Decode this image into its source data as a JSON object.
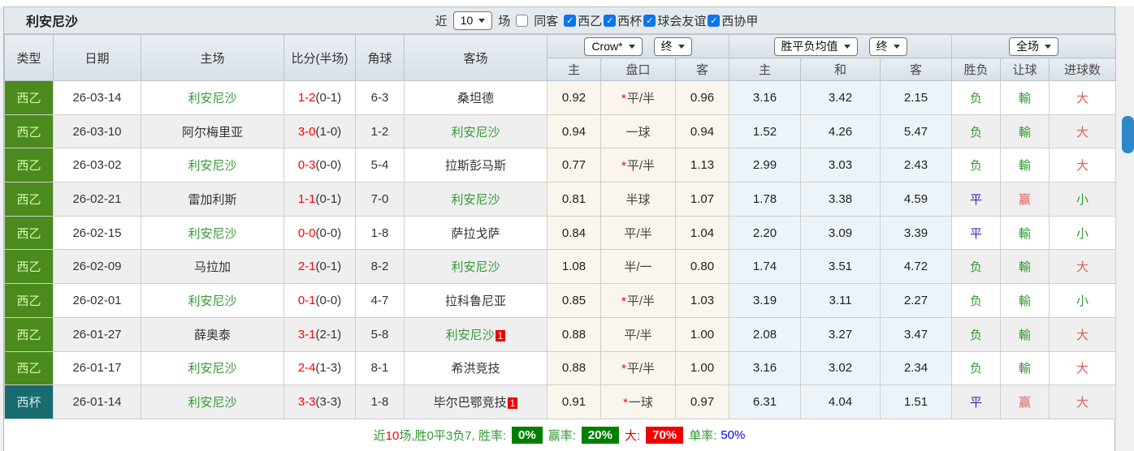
{
  "title": "利安尼沙",
  "controls": {
    "recent_label": "近",
    "recent_value": "10",
    "games_label": "场",
    "same_venue_label": "同客",
    "same_venue_checked": false,
    "checkbox_glyph": "✓",
    "filters": [
      {
        "label": "西乙",
        "checked": true
      },
      {
        "label": "西杯",
        "checked": true
      },
      {
        "label": "球会友谊",
        "checked": true
      },
      {
        "label": "西协甲",
        "checked": true
      }
    ]
  },
  "header": {
    "type": "类型",
    "date": "日期",
    "home": "主场",
    "score": "比分(半场)",
    "corner": "角球",
    "away": "客场",
    "select_odds": "Crow*",
    "select_final1": "终",
    "select_mean": "胜平负均值",
    "select_final2": "终",
    "select_scope": "全场",
    "sub_home1": "主",
    "sub_handicap": "盘口",
    "sub_away1": "客",
    "sub_home2": "主",
    "sub_draw": "和",
    "sub_away2": "客",
    "win_loss": "胜负",
    "handicap_result": "让球",
    "goal_count": "进球数"
  },
  "rows": [
    {
      "type": "西乙",
      "badge": "green",
      "date": "26-03-14",
      "home": "利安尼沙",
      "home_self": true,
      "home_red": "",
      "score": "1-2",
      "half": "(0-1)",
      "corners": "6-3",
      "away": "桑坦德",
      "away_self": false,
      "away_red": "",
      "o1": "0.92",
      "star": "*",
      "hcp": "平/半",
      "o2": "0.96",
      "m1": "3.16",
      "m2": "3.42",
      "m3": "2.15",
      "wl": "负",
      "wl_c": "g",
      "gv": "輸",
      "gv_c": "g",
      "gl": "大",
      "gl_c": "r"
    },
    {
      "type": "西乙",
      "badge": "green",
      "date": "26-03-10",
      "home": "阿尔梅里亚",
      "home_self": false,
      "home_red": "",
      "score": "3-0",
      "half": "(1-0)",
      "corners": "1-2",
      "away": "利安尼沙",
      "away_self": true,
      "away_red": "",
      "o1": "0.94",
      "star": "",
      "hcp": "一球",
      "o2": "0.94",
      "m1": "1.52",
      "m2": "4.26",
      "m3": "5.47",
      "wl": "负",
      "wl_c": "g",
      "gv": "輸",
      "gv_c": "g",
      "gl": "大",
      "gl_c": "r"
    },
    {
      "type": "西乙",
      "badge": "green",
      "date": "26-03-02",
      "home": "利安尼沙",
      "home_self": true,
      "home_red": "",
      "score": "0-3",
      "half": "(0-0)",
      "corners": "5-4",
      "away": "拉斯彭马斯",
      "away_self": false,
      "away_red": "",
      "o1": "0.77",
      "star": "*",
      "hcp": "平/半",
      "o2": "1.13",
      "m1": "2.99",
      "m2": "3.03",
      "m3": "2.43",
      "wl": "负",
      "wl_c": "g",
      "gv": "輸",
      "gv_c": "g",
      "gl": "大",
      "gl_c": "r"
    },
    {
      "type": "西乙",
      "badge": "green",
      "date": "26-02-21",
      "home": "雷加利斯",
      "home_self": false,
      "home_red": "",
      "score": "1-1",
      "half": "(0-1)",
      "corners": "7-0",
      "away": "利安尼沙",
      "away_self": true,
      "away_red": "",
      "o1": "0.81",
      "star": "",
      "hcp": "半球",
      "o2": "1.07",
      "m1": "1.78",
      "m2": "3.38",
      "m3": "4.59",
      "wl": "平",
      "wl_c": "b",
      "gv": "赢",
      "gv_c": "r",
      "gl": "小",
      "gl_c": "g"
    },
    {
      "type": "西乙",
      "badge": "green",
      "date": "26-02-15",
      "home": "利安尼沙",
      "home_self": true,
      "home_red": "",
      "score": "0-0",
      "half": "(0-0)",
      "corners": "1-8",
      "away": "萨拉戈萨",
      "away_self": false,
      "away_red": "",
      "o1": "0.84",
      "star": "",
      "hcp": "平/半",
      "o2": "1.04",
      "m1": "2.20",
      "m2": "3.09",
      "m3": "3.39",
      "wl": "平",
      "wl_c": "b",
      "gv": "輸",
      "gv_c": "g",
      "gl": "小",
      "gl_c": "g"
    },
    {
      "type": "西乙",
      "badge": "green",
      "date": "26-02-09",
      "home": "马拉加",
      "home_self": false,
      "home_red": "",
      "score": "2-1",
      "half": "(0-1)",
      "corners": "8-2",
      "away": "利安尼沙",
      "away_self": true,
      "away_red": "",
      "o1": "1.08",
      "star": "",
      "hcp": "半/一",
      "o2": "0.80",
      "m1": "1.74",
      "m2": "3.51",
      "m3": "4.72",
      "wl": "负",
      "wl_c": "g",
      "gv": "輸",
      "gv_c": "g",
      "gl": "大",
      "gl_c": "r"
    },
    {
      "type": "西乙",
      "badge": "green",
      "date": "26-02-01",
      "home": "利安尼沙",
      "home_self": true,
      "home_red": "",
      "score": "0-1",
      "half": "(0-0)",
      "corners": "4-7",
      "away": "拉科鲁尼亚",
      "away_self": false,
      "away_red": "",
      "o1": "0.85",
      "star": "*",
      "hcp": "平/半",
      "o2": "1.03",
      "m1": "3.19",
      "m2": "3.11",
      "m3": "2.27",
      "wl": "负",
      "wl_c": "g",
      "gv": "輸",
      "gv_c": "g",
      "gl": "小",
      "gl_c": "g"
    },
    {
      "type": "西乙",
      "badge": "green",
      "date": "26-01-27",
      "home": "薛奥泰",
      "home_self": false,
      "home_red": "",
      "score": "3-1",
      "half": "(2-1)",
      "corners": "5-8",
      "away": "利安尼沙",
      "away_self": true,
      "away_red": "1",
      "o1": "0.88",
      "star": "",
      "hcp": "平/半",
      "o2": "1.00",
      "m1": "2.08",
      "m2": "3.27",
      "m3": "3.47",
      "wl": "负",
      "wl_c": "g",
      "gv": "輸",
      "gv_c": "g",
      "gl": "大",
      "gl_c": "r"
    },
    {
      "type": "西乙",
      "badge": "green",
      "date": "26-01-17",
      "home": "利安尼沙",
      "home_self": true,
      "home_red": "",
      "score": "2-4",
      "half": "(1-3)",
      "corners": "8-1",
      "away": "希洪竞技",
      "away_self": false,
      "away_red": "",
      "o1": "0.88",
      "star": "*",
      "hcp": "平/半",
      "o2": "1.00",
      "m1": "3.16",
      "m2": "3.02",
      "m3": "2.34",
      "wl": "负",
      "wl_c": "g",
      "gv": "輸",
      "gv_c": "g",
      "gl": "大",
      "gl_c": "r"
    },
    {
      "type": "西杯",
      "badge": "teal",
      "date": "26-01-14",
      "home": "利安尼沙",
      "home_self": true,
      "home_red": "",
      "score": "3-3",
      "half": "(3-3)",
      "corners": "1-8",
      "away": "毕尔巴鄂竞技",
      "away_self": false,
      "away_red": "1",
      "o1": "0.91",
      "star": "*",
      "hcp": "一球",
      "o2": "0.97",
      "m1": "6.31",
      "m2": "4.04",
      "m3": "1.51",
      "wl": "平",
      "wl_c": "b",
      "gv": "赢",
      "gv_c": "r",
      "gl": "大",
      "gl_c": "r"
    }
  ],
  "footer": {
    "recent_label": "近",
    "recent_num": "10",
    "summary": "场,胜0平3负7, 胜率:",
    "win_pct": "0%",
    "win_rate_label": "赢率:",
    "win_rate_pct": "20%",
    "big_label": "大:",
    "big_pct": "70%",
    "single_label": "单率:",
    "single_value": "50%"
  },
  "colors": {
    "green_text": "#339933",
    "red_text": "#ff0000",
    "result_red": "#e05c5c",
    "blue_text": "#2e2ebf",
    "league_badge_bg": "#4b8b1e",
    "cup_badge_bg": "#186b6e",
    "checkbox_blue": "#0d76e8",
    "scroll_thumb_blue": "#2c88c9",
    "pct_green_bg": "#008000",
    "pct_red_bg": "#ee0000",
    "single_value_blue": "#0000ee"
  }
}
